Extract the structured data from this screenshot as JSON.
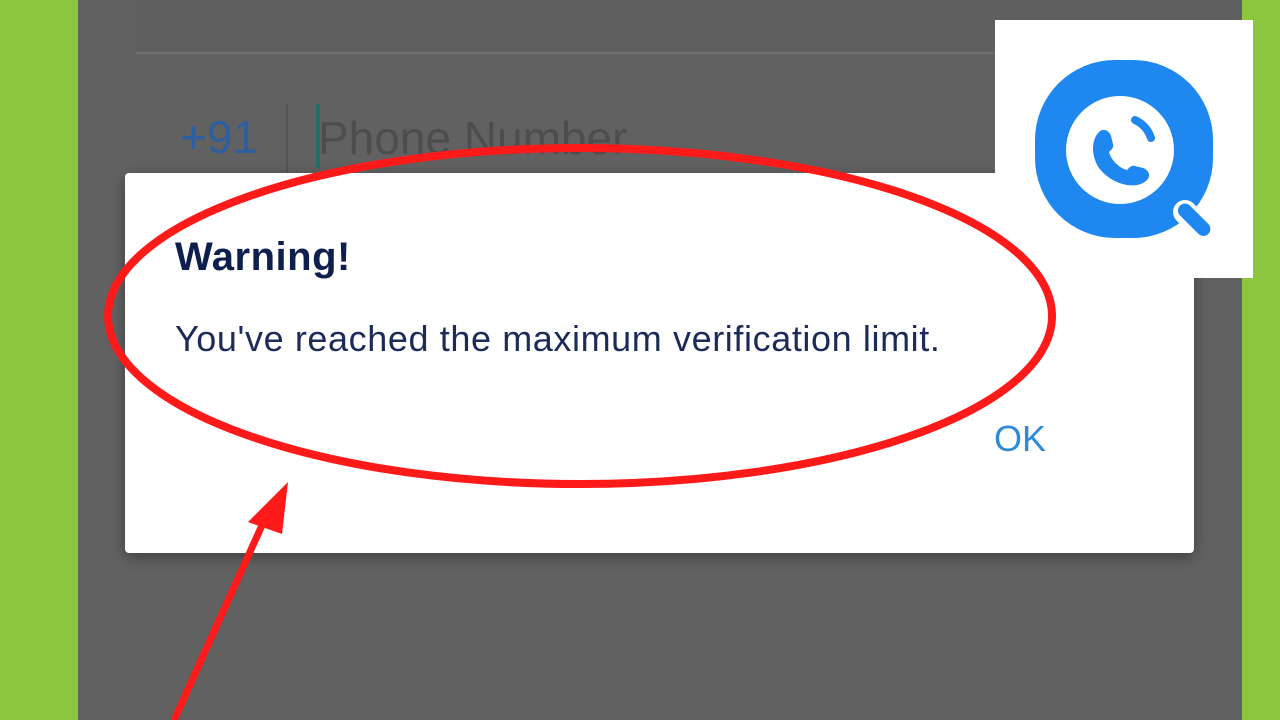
{
  "phone_form": {
    "country_code": "+91",
    "phone_placeholder": "Phone Number",
    "phone_value": ""
  },
  "dialog": {
    "title": "Warning!",
    "message": "You've reached the maximum verification limit.",
    "ok_label": "OK"
  },
  "logo": {
    "icon": "truecaller-logo-icon",
    "brand_color": "#1e88f0"
  },
  "annotation": {
    "highlight_color": "#ff1a1a",
    "shapes": [
      "highlight-ellipse",
      "pointer-arrow"
    ]
  },
  "colors": {
    "frame_green": "#8cc63f",
    "overlay_gray": "#616161",
    "dialog_bg": "#ffffff",
    "title_color": "#0e1f4d",
    "button_color": "#2f8bd9"
  }
}
